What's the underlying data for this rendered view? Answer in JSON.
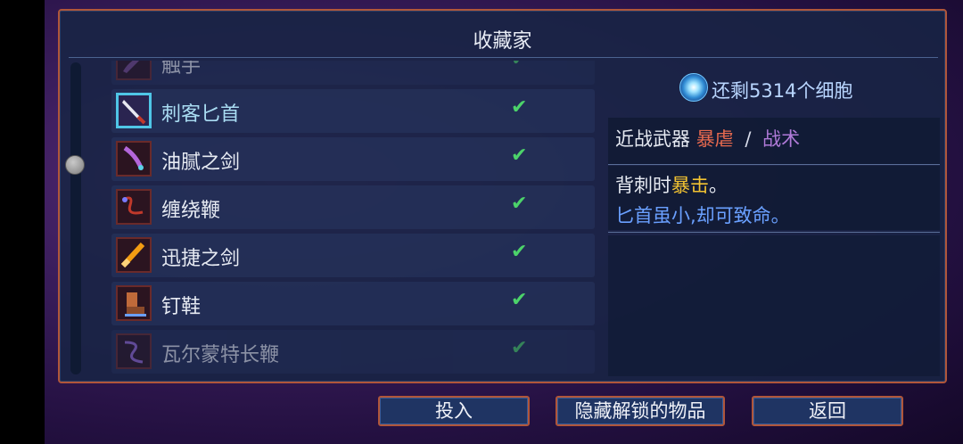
{
  "panel": {
    "title": "收藏家"
  },
  "items": [
    {
      "label": "触手",
      "checked": true,
      "icon": "tentacle-icon"
    },
    {
      "label": "刺客匕首",
      "checked": true,
      "icon": "assassin-dagger-icon"
    },
    {
      "label": "油腻之剑",
      "checked": true,
      "icon": "oiled-sword-icon"
    },
    {
      "label": "缠绕鞭",
      "checked": true,
      "icon": "whip-icon"
    },
    {
      "label": "迅捷之剑",
      "checked": true,
      "icon": "swift-sword-icon"
    },
    {
      "label": "钉鞋",
      "checked": true,
      "icon": "spiked-boots-icon"
    },
    {
      "label": "瓦尔蒙特长鞭",
      "checked": true,
      "icon": "vorpan-whip-icon"
    }
  ],
  "check_glyph": "✔",
  "detail": {
    "cells_text": "还剩5314个细胞",
    "type_prefix": "近战武器",
    "tag_brutality": "暴虐",
    "tag_separator": "/",
    "tag_tactics": "战术",
    "desc_prefix": "背刺时",
    "desc_crit": "暴击",
    "desc_suffix": "。",
    "desc_line2": "匕首虽小,却可致命。"
  },
  "buttons": {
    "invest": "投入",
    "hide_unlocked": "隐藏解锁的物品",
    "back": "返回"
  },
  "colors": {
    "border": "#b0563a",
    "check": "#4cd36a",
    "brutality": "#e86a4f",
    "tactics": "#b07ad8",
    "crit": "#f1c232",
    "flavor": "#6aa0ff"
  }
}
